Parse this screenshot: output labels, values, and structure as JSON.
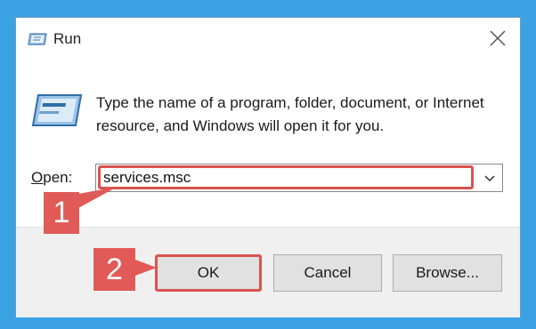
{
  "window": {
    "title": "Run",
    "icon": "run-icon"
  },
  "description": "Type the name of a program, folder, document, or Internet resource, and Windows will open it for you.",
  "open": {
    "label_mnemonic": "O",
    "label_rest": "pen:",
    "value": "services.msc",
    "dropdown_icon": "chevron-down-icon"
  },
  "buttons": {
    "ok": "OK",
    "cancel": "Cancel",
    "browse": "Browse..."
  },
  "annotations": {
    "step1": "1",
    "step2": "2",
    "accent_color": "#e05a58"
  },
  "colors": {
    "background": "#3aa2e3",
    "window": "#ffffff",
    "footer": "#f0f0f0"
  }
}
